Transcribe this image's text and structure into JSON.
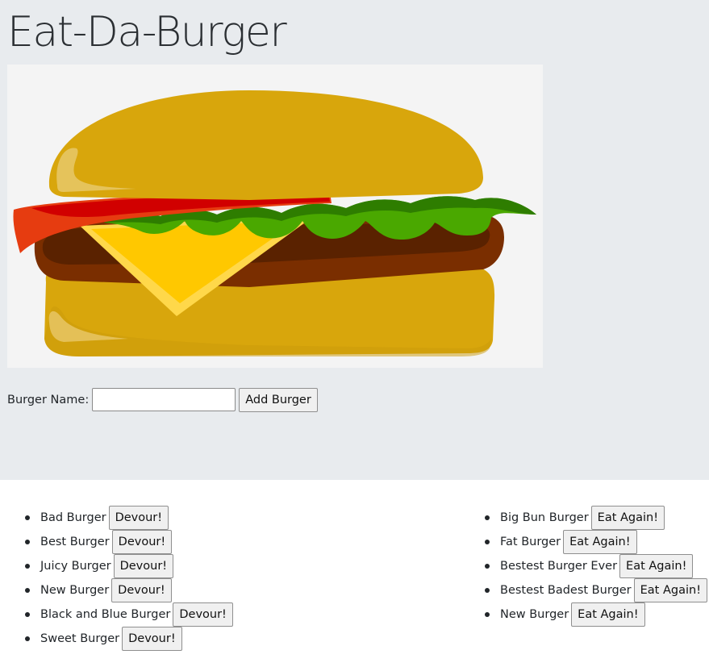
{
  "header": {
    "title": "Eat-Da-Burger"
  },
  "hero": {
    "image": "burger-illustration"
  },
  "form": {
    "label": "Burger Name:",
    "input_value": "",
    "input_placeholder": "",
    "submit_label": "Add Burger"
  },
  "not_devoured": {
    "button_label": "Devour!",
    "items": [
      {
        "name": "Bad Burger"
      },
      {
        "name": "Best Burger"
      },
      {
        "name": "Juicy Burger"
      },
      {
        "name": "New Burger"
      },
      {
        "name": "Black and Blue Burger"
      },
      {
        "name": "Sweet Burger"
      }
    ]
  },
  "devoured": {
    "button_label": "Eat Again!",
    "items": [
      {
        "name": "Big Bun Burger"
      },
      {
        "name": "Fat Burger"
      },
      {
        "name": "Bestest Burger Ever"
      },
      {
        "name": "Bestest Badest Burger"
      },
      {
        "name": "New Burger"
      }
    ]
  },
  "colors": {
    "jumbotron_bg": "#e8ebee",
    "bun": "#d8a60c",
    "patty": "#7a2e00",
    "cheese": "#ffc800",
    "lettuce": "#4aa800",
    "tomato": "#e03a10"
  }
}
